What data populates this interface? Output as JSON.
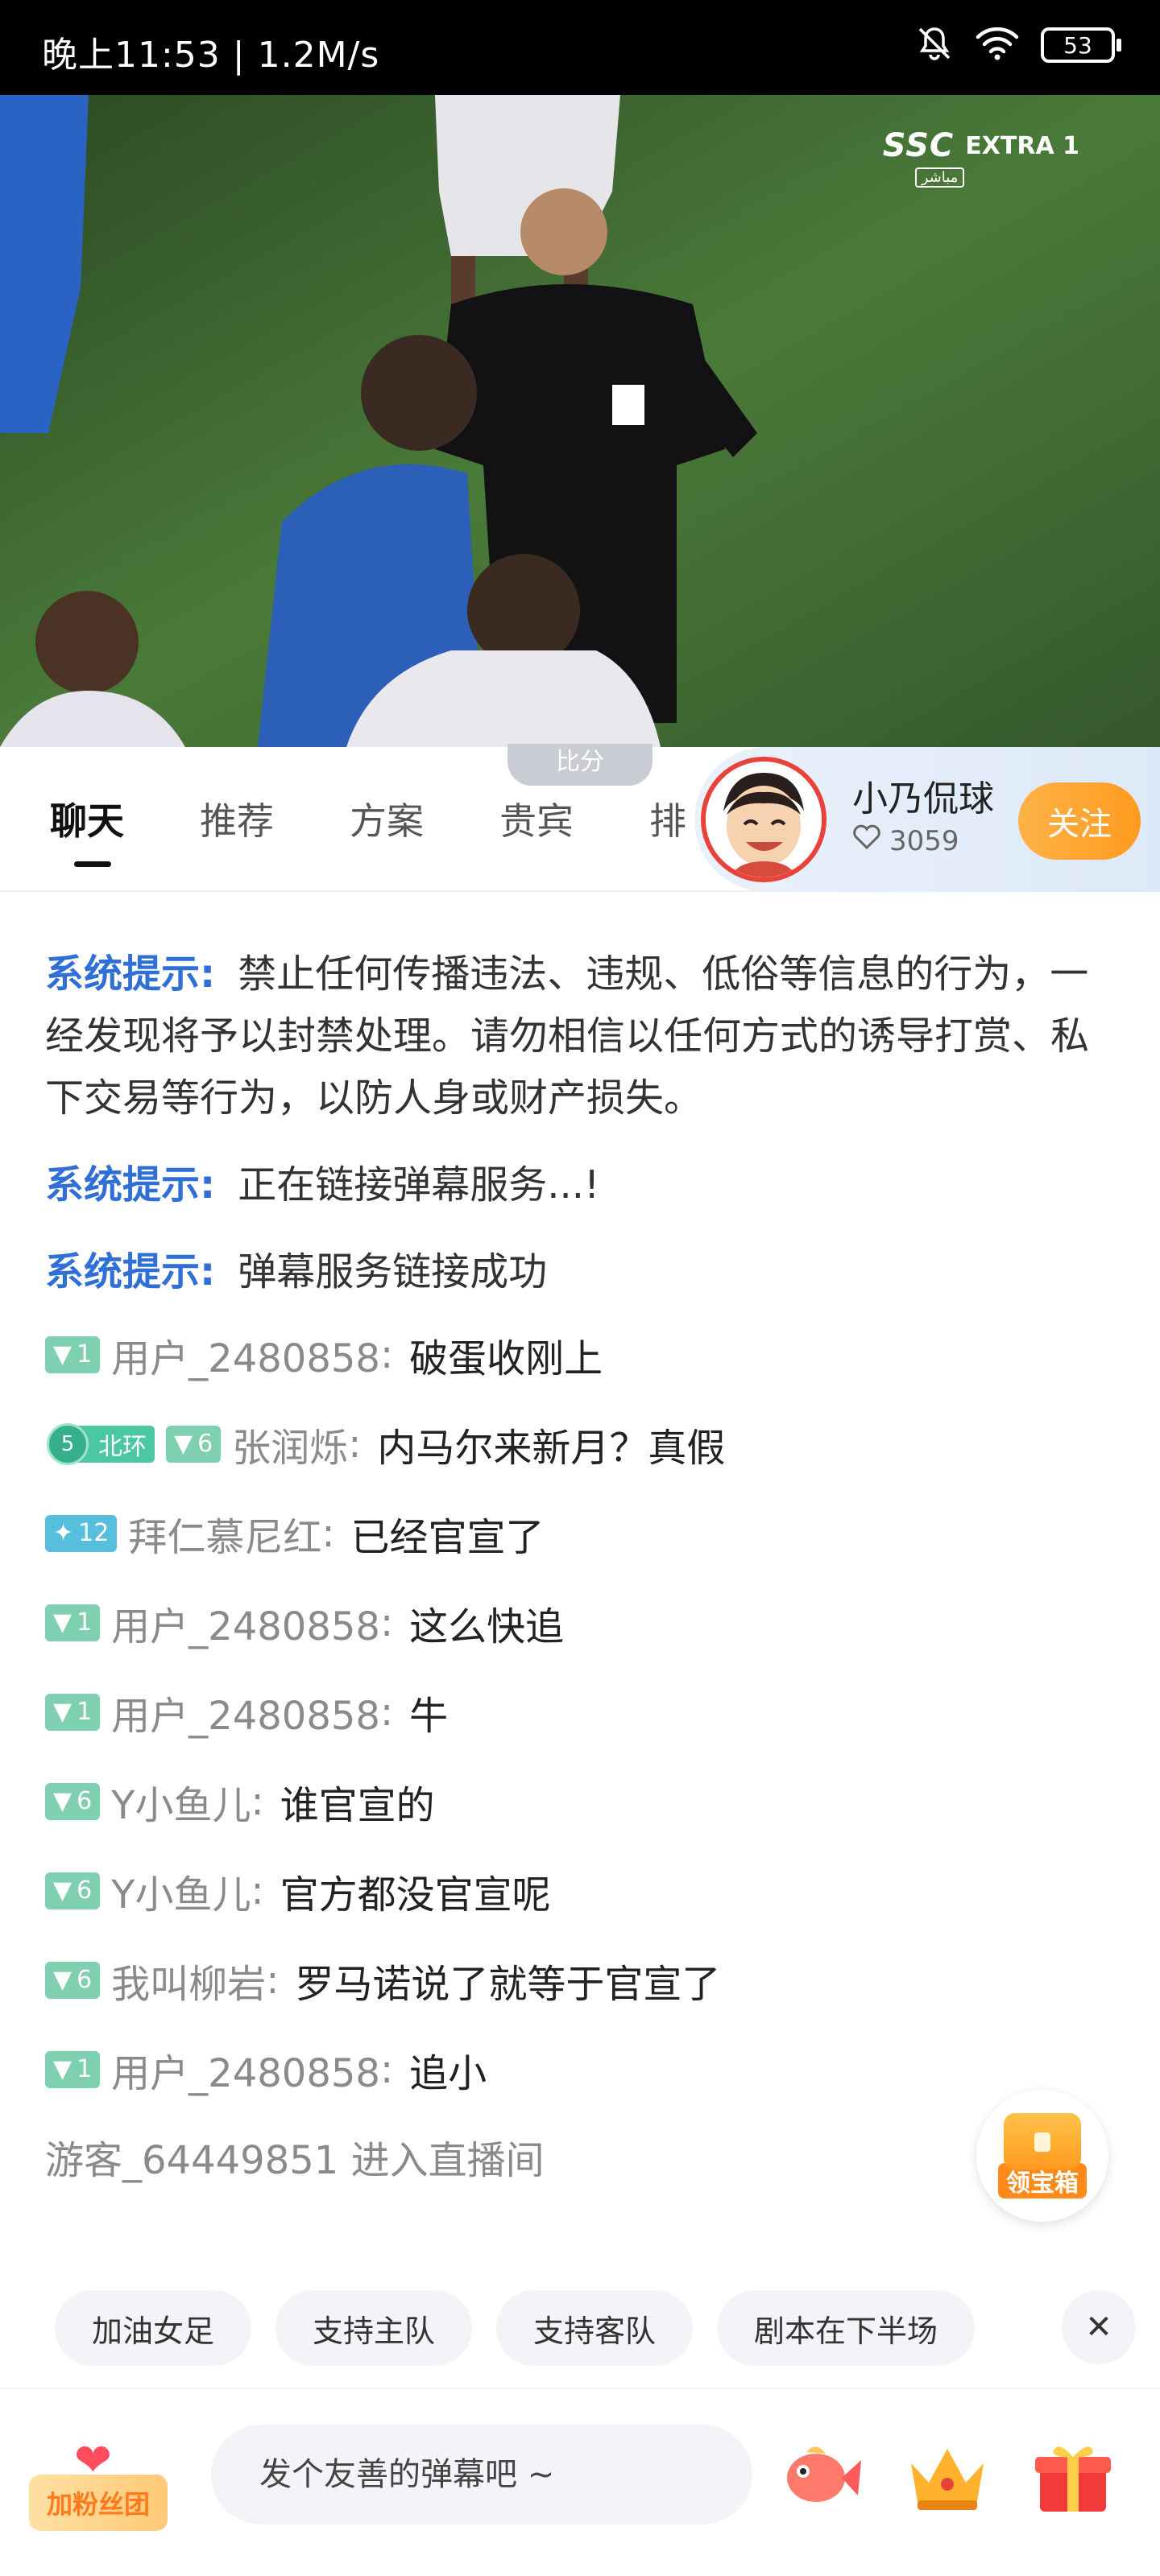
{
  "status_bar": {
    "time_speed": "晚上11:53 | 1.2M/s",
    "battery": "53",
    "icons": [
      "mute-bell-icon",
      "wifi-icon",
      "battery-icon"
    ]
  },
  "video": {
    "channel_logo": "SSC",
    "channel_extra": "EXTRA 1",
    "channel_sub": "مباشر"
  },
  "score_tab": "比分",
  "tabs": [
    {
      "label": "聊天",
      "active": true
    },
    {
      "label": "推荐"
    },
    {
      "label": "方案"
    },
    {
      "label": "贵宾"
    },
    {
      "label": "排"
    }
  ],
  "anchor": {
    "name": "小乃侃球",
    "likes": "3059",
    "follow_label": "关注"
  },
  "chat": {
    "system_messages": [
      {
        "tag": "系统提示:",
        "text": "禁止任何传播违法、违规、低俗等信息的行为，一经发现将予以封禁处理。请勿相信以任何方式的诱导打赏、私下交易等行为，以防人身或财产损失。"
      },
      {
        "tag": "系统提示:",
        "text": "正在链接弹幕服务...!"
      },
      {
        "tag": "系统提示:",
        "text": "弹幕服务链接成功"
      }
    ],
    "messages": [
      {
        "level": "1",
        "user": "用户_2480858",
        "text": "破蛋收刚上"
      },
      {
        "club_level": "5",
        "club": "北环",
        "level": "6",
        "user": "张润烁",
        "text": "内马尔来新月？真假"
      },
      {
        "level": "12",
        "user": "拜仁慕尼红",
        "text": "已经官宣了"
      },
      {
        "level": "1",
        "user": "用户_2480858",
        "text": "这么快追"
      },
      {
        "level": "1",
        "user": "用户_2480858",
        "text": "牛"
      },
      {
        "level": "6",
        "user": "Y小鱼儿",
        "text": "谁官宣的"
      },
      {
        "level": "6",
        "user": "Y小鱼儿",
        "text": "官方都没官宣呢"
      },
      {
        "level": "6",
        "user": "我叫柳岩",
        "text": "罗马诺说了就等于官宣了"
      },
      {
        "level": "1",
        "user": "用户_2480858",
        "text": "追小"
      }
    ],
    "enter_notice": "游客_64449851 进入直播间"
  },
  "treasure_label": "领宝箱",
  "quick_chips": [
    "加油女足",
    "支持主队",
    "支持客队",
    "剧本在下半场"
  ],
  "bottom_bar": {
    "fans_label": "加粉丝团",
    "input_placeholder": "发个友善的弹幕吧 ~",
    "gift_icons": [
      "fish-gift-icon",
      "crown-gift-icon",
      "giftbox-icon"
    ]
  },
  "colors": {
    "system_tag": "#2f6fd6",
    "follow_button": "#ff9a1f",
    "level_badge": "#7fcfb1"
  }
}
